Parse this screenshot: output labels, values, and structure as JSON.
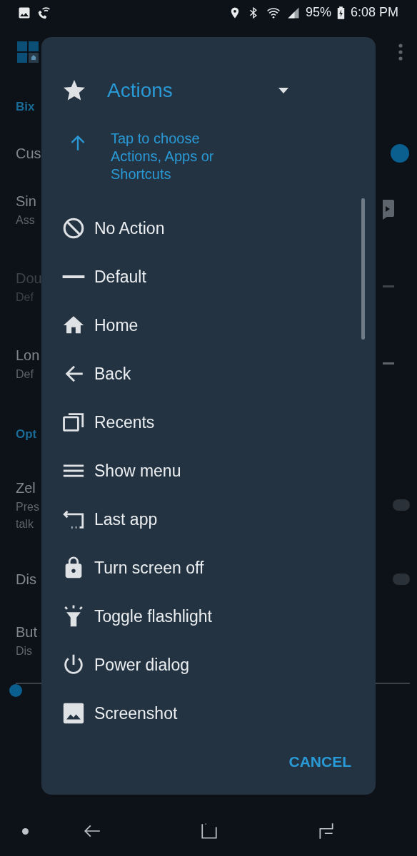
{
  "status_bar": {
    "battery": "95%",
    "time": "6:08 PM"
  },
  "app_background": {
    "rows": [
      {
        "kind": "section",
        "title": "Bix"
      },
      {
        "kind": "switch",
        "title": "Cus",
        "on": true
      },
      {
        "kind": "action",
        "title": "Sin",
        "summary": "Ass",
        "default_action": false,
        "disabled": false
      },
      {
        "kind": "action",
        "title": "Dou",
        "summary": "Def",
        "default_action": true,
        "disabled": true
      },
      {
        "kind": "action",
        "title": "Lon",
        "summary": "Def",
        "default_action": true,
        "disabled": false
      },
      {
        "kind": "section",
        "title": "Opt"
      },
      {
        "kind": "switch",
        "title": "Zel",
        "summary": "Pres",
        "summary2": "talk",
        "on": false
      },
      {
        "kind": "switch",
        "title": "Dis",
        "on": false
      },
      {
        "kind": "slider",
        "title": "But",
        "summary": "Dis",
        "level": 0
      }
    ]
  },
  "dialog": {
    "title": "Actions",
    "hint": "Tap to choose Actions, Apps or Shortcuts",
    "items": [
      {
        "kind": "none",
        "label": "No Action"
      },
      {
        "kind": "default",
        "label": "Default"
      },
      {
        "kind": "home",
        "label": "Home"
      },
      {
        "kind": "back",
        "label": "Back"
      },
      {
        "kind": "recents",
        "label": "Recents"
      },
      {
        "kind": "menu",
        "label": "Show menu"
      },
      {
        "kind": "last-app",
        "label": "Last app"
      },
      {
        "kind": "lock",
        "label": "Turn screen off"
      },
      {
        "kind": "flashlight",
        "label": "Toggle flashlight"
      },
      {
        "kind": "power",
        "label": "Power dialog"
      },
      {
        "kind": "screenshot",
        "label": "Screenshot"
      }
    ],
    "cancel": "CANCEL"
  }
}
